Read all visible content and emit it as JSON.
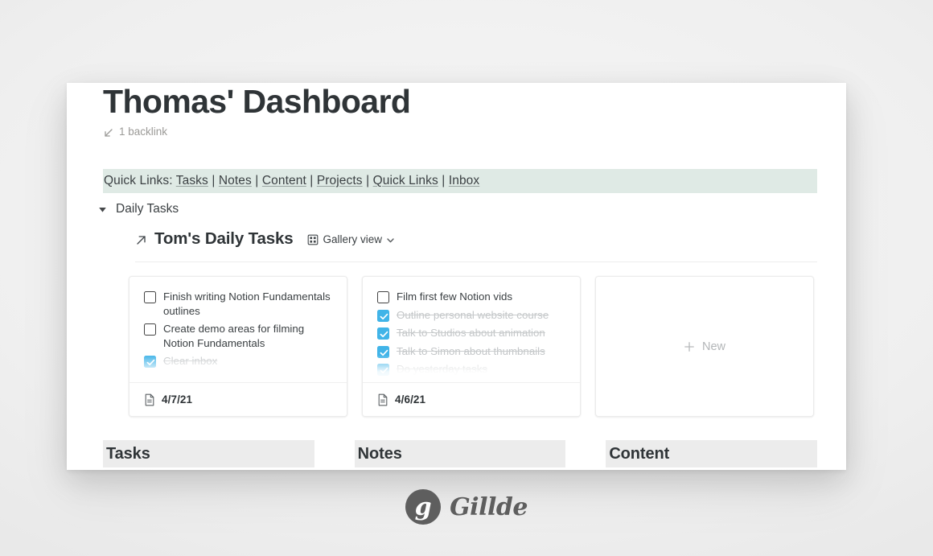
{
  "page": {
    "title": "Thomas' Dashboard",
    "backlink_label": "1 backlink",
    "backlink_icon": "arrow-down-left-icon"
  },
  "quick_links": {
    "label": "Quick Links:",
    "links": [
      "Tasks",
      "Notes",
      "Content",
      "Projects",
      "Quick Links",
      "Inbox"
    ],
    "separator": "|",
    "background_color": "#dfeae5"
  },
  "toggle": {
    "label": "Daily Tasks",
    "arrow_icon": "triangle-down-icon",
    "expanded": true
  },
  "database": {
    "link_icon": "arrow-up-right-icon",
    "title": "Tom's Daily Tasks",
    "view_icon": "grid-gallery-icon",
    "view_name": "Gallery view",
    "chevron_icon": "chevron-down-icon"
  },
  "gallery": {
    "cards": [
      {
        "items": [
          {
            "text": "Finish writing Notion Fundamentals outlines",
            "checked": false
          },
          {
            "text": "Create demo areas for filming Notion Fundamentals",
            "checked": false
          },
          {
            "text": "Clear inbox",
            "checked": true
          }
        ],
        "footer_icon": "document-icon",
        "date": "4/7/21"
      },
      {
        "items": [
          {
            "text": "Film first few Notion vids",
            "checked": false
          },
          {
            "text": "Outline personal website course",
            "checked": true
          },
          {
            "text": "Talk to Studios about animation",
            "checked": true
          },
          {
            "text": "Talk to Simon about thumbnails",
            "checked": true
          },
          {
            "text": "Do yesterday tasks",
            "checked": true
          }
        ],
        "footer_icon": "document-icon",
        "date": "4/6/21"
      }
    ],
    "new_card": {
      "icon": "plus-icon",
      "label": "New"
    },
    "checked_color": "#41b4e8"
  },
  "columns": [
    {
      "title": "Tasks"
    },
    {
      "title": "Notes"
    },
    {
      "title": "Content"
    }
  ],
  "watermark": {
    "mark": "g",
    "name": "Gillde",
    "color": "#5e5e5e"
  }
}
